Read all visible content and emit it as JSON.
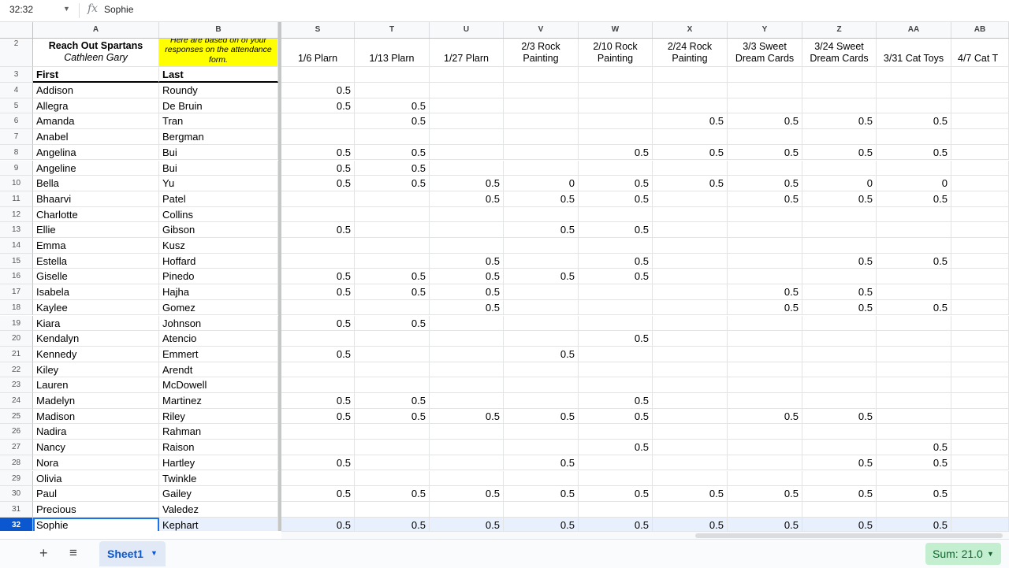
{
  "formula_bar": {
    "cell_ref": "32:32",
    "fx": "fx",
    "value": "Sophie"
  },
  "columns": [
    "A",
    "B",
    "S",
    "T",
    "U",
    "V",
    "W",
    "X",
    "Y",
    "Z",
    "AA",
    "AB"
  ],
  "row2": {
    "row_label": "2",
    "a_line1": "Reach Out Spartans",
    "a_line2": "Cathleen Gary",
    "b_text": "Here are based on of your responses on the attendance form.",
    "events": [
      "1/6 Plarn",
      "1/13 Plarn",
      "1/27 Plarn",
      "2/3 Rock Painting",
      "2/10 Rock Painting",
      "2/24 Rock Painting",
      "3/3 Sweet Dream Cards",
      "3/24 Sweet Dream Cards",
      "3/31 Cat Toys",
      "4/7 Cat T"
    ]
  },
  "row3": {
    "row_label": "3",
    "first": "First",
    "last": "Last"
  },
  "rows": [
    {
      "n": "4",
      "first": "Addison",
      "last": "Roundy",
      "v": [
        "0.5",
        "",
        "",
        "",
        "",
        "",
        "",
        "",
        "",
        ""
      ]
    },
    {
      "n": "5",
      "first": "Allegra",
      "last": "De Bruin",
      "v": [
        "0.5",
        "0.5",
        "",
        "",
        "",
        "",
        "",
        "",
        "",
        ""
      ]
    },
    {
      "n": "6",
      "first": "Amanda",
      "last": "Tran",
      "v": [
        "",
        "0.5",
        "",
        "",
        "",
        "0.5",
        "0.5",
        "0.5",
        "0.5",
        ""
      ]
    },
    {
      "n": "7",
      "first": "Anabel",
      "last": "Bergman",
      "v": [
        "",
        "",
        "",
        "",
        "",
        "",
        "",
        "",
        "",
        ""
      ]
    },
    {
      "n": "8",
      "first": "Angelina",
      "last": "Bui",
      "v": [
        "0.5",
        "0.5",
        "",
        "",
        "0.5",
        "0.5",
        "0.5",
        "0.5",
        "0.5",
        ""
      ]
    },
    {
      "n": "9",
      "first": "Angeline",
      "last": "Bui",
      "v": [
        "0.5",
        "0.5",
        "",
        "",
        "",
        "",
        "",
        "",
        "",
        ""
      ]
    },
    {
      "n": "10",
      "first": "Bella",
      "last": "Yu",
      "v": [
        "0.5",
        "0.5",
        "0.5",
        "0",
        "0.5",
        "0.5",
        "0.5",
        "0",
        "0",
        ""
      ]
    },
    {
      "n": "11",
      "first": "Bhaarvi",
      "last": "Patel",
      "v": [
        "",
        "",
        "0.5",
        "0.5",
        "0.5",
        "",
        "0.5",
        "0.5",
        "0.5",
        ""
      ]
    },
    {
      "n": "12",
      "first": "Charlotte",
      "last": "Collins",
      "v": [
        "",
        "",
        "",
        "",
        "",
        "",
        "",
        "",
        "",
        ""
      ]
    },
    {
      "n": "13",
      "first": "Ellie",
      "last": "Gibson",
      "v": [
        "0.5",
        "",
        "",
        "0.5",
        "0.5",
        "",
        "",
        "",
        "",
        ""
      ]
    },
    {
      "n": "14",
      "first": "Emma",
      "last": "Kusz",
      "v": [
        "",
        "",
        "",
        "",
        "",
        "",
        "",
        "",
        "",
        ""
      ]
    },
    {
      "n": "15",
      "first": "Estella",
      "last": "Hoffard",
      "v": [
        "",
        "",
        "0.5",
        "",
        "0.5",
        "",
        "",
        "0.5",
        "0.5",
        ""
      ]
    },
    {
      "n": "16",
      "first": "Giselle",
      "last": "Pinedo",
      "v": [
        "0.5",
        "0.5",
        "0.5",
        "0.5",
        "0.5",
        "",
        "",
        "",
        "",
        ""
      ]
    },
    {
      "n": "17",
      "first": "Isabela",
      "last": "Hajha",
      "v": [
        "0.5",
        "0.5",
        "0.5",
        "",
        "",
        "",
        "0.5",
        "0.5",
        "",
        ""
      ]
    },
    {
      "n": "18",
      "first": "Kaylee",
      "last": "Gomez",
      "v": [
        "",
        "",
        "0.5",
        "",
        "",
        "",
        "0.5",
        "0.5",
        "0.5",
        ""
      ]
    },
    {
      "n": "19",
      "first": "Kiara",
      "last": "Johnson",
      "v": [
        "0.5",
        "0.5",
        "",
        "",
        "",
        "",
        "",
        "",
        "",
        ""
      ]
    },
    {
      "n": "20",
      "first": "Kendalyn",
      "last": "Atencio",
      "v": [
        "",
        "",
        "",
        "",
        "0.5",
        "",
        "",
        "",
        "",
        ""
      ]
    },
    {
      "n": "21",
      "first": "Kennedy",
      "last": "Emmert",
      "v": [
        "0.5",
        "",
        "",
        "0.5",
        "",
        "",
        "",
        "",
        "",
        ""
      ]
    },
    {
      "n": "22",
      "first": "Kiley",
      "last": "Arendt",
      "v": [
        "",
        "",
        "",
        "",
        "",
        "",
        "",
        "",
        "",
        ""
      ]
    },
    {
      "n": "23",
      "first": "Lauren",
      "last": "McDowell",
      "v": [
        "",
        "",
        "",
        "",
        "",
        "",
        "",
        "",
        "",
        ""
      ]
    },
    {
      "n": "24",
      "first": "Madelyn",
      "last": "Martinez",
      "v": [
        "0.5",
        "0.5",
        "",
        "",
        "0.5",
        "",
        "",
        "",
        "",
        ""
      ]
    },
    {
      "n": "25",
      "first": "Madison",
      "last": "Riley",
      "v": [
        "0.5",
        "0.5",
        "0.5",
        "0.5",
        "0.5",
        "",
        "0.5",
        "0.5",
        "",
        ""
      ]
    },
    {
      "n": "26",
      "first": "Nadira",
      "last": "Rahman",
      "v": [
        "",
        "",
        "",
        "",
        "",
        "",
        "",
        "",
        "",
        ""
      ]
    },
    {
      "n": "27",
      "first": "Nancy",
      "last": "Raison",
      "v": [
        "",
        "",
        "",
        "",
        "0.5",
        "",
        "",
        "",
        "0.5",
        ""
      ]
    },
    {
      "n": "28",
      "first": "Nora",
      "last": "Hartley",
      "v": [
        "0.5",
        "",
        "",
        "0.5",
        "",
        "",
        "",
        "0.5",
        "0.5",
        ""
      ]
    },
    {
      "n": "29",
      "first": "Olivia",
      "last": "Twinkle",
      "v": [
        "",
        "",
        "",
        "",
        "",
        "",
        "",
        "",
        "",
        ""
      ]
    },
    {
      "n": "30",
      "first": "Paul",
      "last": "Gailey",
      "v": [
        "0.5",
        "0.5",
        "0.5",
        "0.5",
        "0.5",
        "0.5",
        "0.5",
        "0.5",
        "0.5",
        ""
      ]
    },
    {
      "n": "31",
      "first": "Precious",
      "last": "Valedez",
      "v": [
        "",
        "",
        "",
        "",
        "",
        "",
        "",
        "",
        "",
        ""
      ]
    },
    {
      "n": "32",
      "first": "Sophie",
      "last": "Kephart",
      "v": [
        "0.5",
        "0.5",
        "0.5",
        "0.5",
        "0.5",
        "0.5",
        "0.5",
        "0.5",
        "0.5",
        ""
      ],
      "selected": true
    }
  ],
  "tabs": {
    "add_icon": "+",
    "all_sheets_icon": "≡",
    "sheet_name": "Sheet1",
    "dropdown_icon": "▼"
  },
  "status": {
    "sum": "Sum: 21.0"
  },
  "colors": {
    "accent": "#0b57d0",
    "highlight": "#ffff00",
    "sum_bg": "#c4eed0"
  }
}
